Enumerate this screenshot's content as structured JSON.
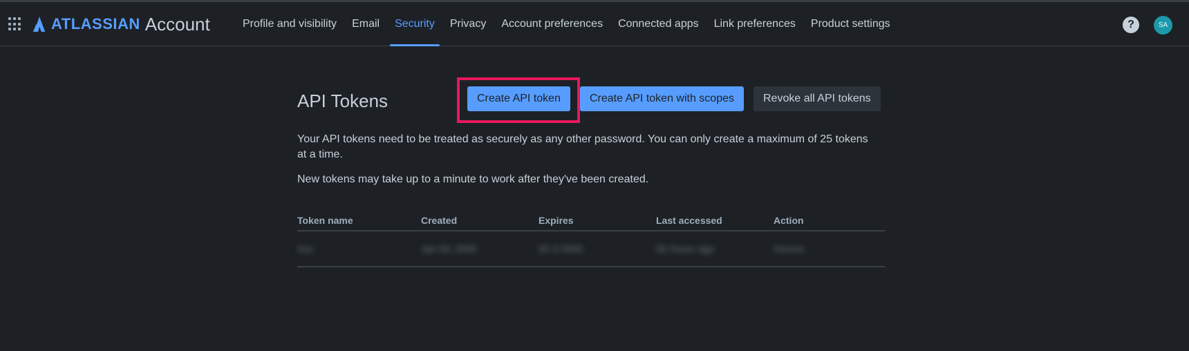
{
  "brand": {
    "word": "ATLASSIAN",
    "product": "Account"
  },
  "nav": {
    "tabs": [
      {
        "label": "Profile and visibility"
      },
      {
        "label": "Email"
      },
      {
        "label": "Security"
      },
      {
        "label": "Privacy"
      },
      {
        "label": "Account preferences"
      },
      {
        "label": "Connected apps"
      },
      {
        "label": "Link preferences"
      },
      {
        "label": "Product settings"
      }
    ],
    "active_tab": "Security",
    "help_glyph": "?",
    "avatar_initials": "SA"
  },
  "page": {
    "title": "API Tokens",
    "buttons": {
      "create": "Create API token",
      "create_scoped": "Create API token with scopes",
      "revoke_all": "Revoke all API tokens"
    },
    "description": "Your API tokens need to be treated as securely as any other password. You can only create a maximum of 25 tokens at a time.",
    "note": "New tokens may take up to a minute to work after they've been created."
  },
  "table": {
    "columns": [
      "Token name",
      "Created",
      "Expires",
      "Last accessed",
      "Action"
    ],
    "rows": [
      {
        "cells": [
          "Xxx",
          "Jan 00, 0000",
          "00 X 0000",
          "00 Xxxxx ago",
          "Xxxxxx"
        ]
      }
    ]
  },
  "colors": {
    "background": "#1d2125",
    "accent": "#579dff",
    "highlight_border": "#e8185e",
    "avatar": "#1d9aaa"
  },
  "icons": [
    "app-switcher-icon",
    "atlassian-logo-icon",
    "help-icon"
  ]
}
